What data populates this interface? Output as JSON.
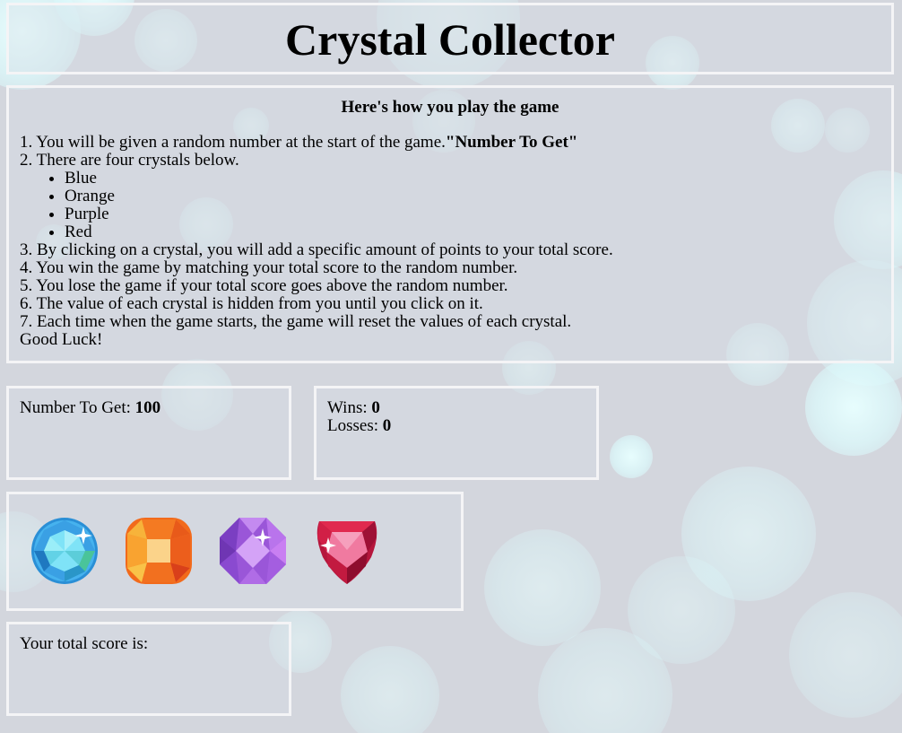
{
  "title": "Crystal Collector",
  "rules": {
    "heading": "Here's how you play the game",
    "step1_text": "1. You will be given a random number at the start of the game.",
    "step1_bold": "\"Number To Get\"",
    "step2": "2. There are four crystals below.",
    "crystals": [
      "Blue",
      "Orange",
      "Purple",
      "Red"
    ],
    "step3": "3. By clicking on a crystal, you will add a specific amount of points to your total score.",
    "step4": "4. You win the game by matching your total score to the random number.",
    "step5": "5. You lose the game if your total score goes above the random number.",
    "step6": "6. The value of each crystal is hidden from you until you click on it.",
    "step7": "7. Each time when the game starts, the game will reset the values of each crystal.",
    "closing": "Good Luck!"
  },
  "target": {
    "label": "Number To Get: ",
    "value": "100"
  },
  "scoreboard": {
    "wins_label": "Wins: ",
    "wins": "0",
    "losses_label": "Losses: ",
    "losses": "0"
  },
  "crystal_buttons": [
    {
      "name": "blue-crystal-icon",
      "color": "#3aa6e8"
    },
    {
      "name": "orange-crystal-icon",
      "color": "#f07a2a"
    },
    {
      "name": "purple-crystal-icon",
      "color": "#a765e0"
    },
    {
      "name": "red-crystal-icon",
      "color": "#d8234a"
    }
  ],
  "total": {
    "label": "Your total score is:",
    "value": ""
  }
}
